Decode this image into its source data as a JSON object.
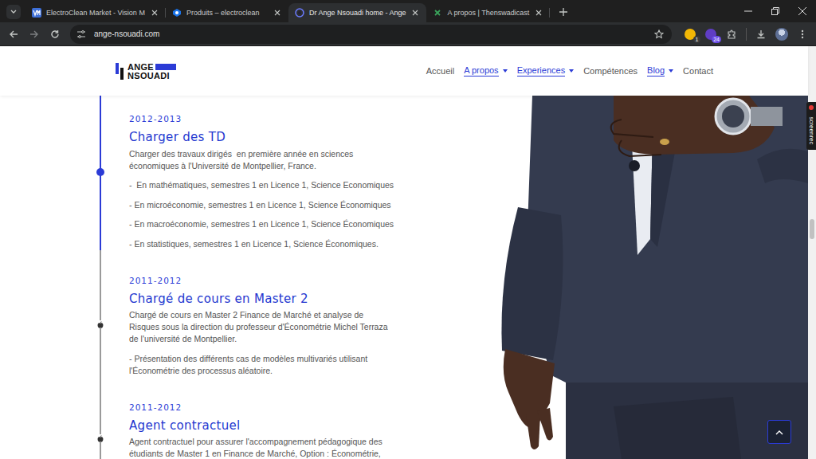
{
  "browser": {
    "tabs": [
      {
        "label": "ElectroClean Market - Vision M",
        "selected": false
      },
      {
        "label": "Produits – electroclean",
        "selected": false
      },
      {
        "label": "Dr Ange Nsouadi home - Ange",
        "selected": true
      },
      {
        "label": "A propos | Thenswadicast",
        "selected": false
      }
    ],
    "url": "ange-nsouadi.com",
    "extensions": [
      {
        "badge": "1",
        "color": "#f2b705"
      },
      {
        "badge": "24",
        "color": "#5f3dc4"
      }
    ]
  },
  "site": {
    "logo": {
      "top": "ANGE",
      "bottom": "NSOUADI"
    },
    "nav": [
      {
        "label": "Accueil",
        "has_dropdown": false
      },
      {
        "label": "A propos",
        "has_dropdown": true
      },
      {
        "label": "Experiences",
        "has_dropdown": true
      },
      {
        "label": "Compétences",
        "has_dropdown": false
      },
      {
        "label": "Blog",
        "has_dropdown": true
      },
      {
        "label": "Contact",
        "has_dropdown": false
      }
    ]
  },
  "timeline": [
    {
      "period": "2012-2013",
      "title": "Charger des TD",
      "active": true,
      "description": [
        "Charger des travaux dirigés  en première année en sciences",
        "économiques à l'Université de Montpellier, France."
      ],
      "bullets": [
        [
          "-  En mathématiques, semestres 1 en Licence 1, Science Economiques"
        ],
        [
          "- En microéconomie, semestres 1 en Licence 1, Science Économiques"
        ],
        [
          "- En macroéconomie, semestres 1 en Licence 1, Science Économiques"
        ],
        [
          "- En statistiques, semestres 1 en Licence 1, Science Économiques."
        ]
      ]
    },
    {
      "period": "2011-2012",
      "title": "Chargé de cours en Master 2",
      "active": false,
      "description": [
        "Chargé de cours en Master 2 Finance de Marché et analyse de",
        "Risques sous la direction du professeur d'Économétrie Michel Terraza",
        "de l'université de Montpellier."
      ],
      "bullets": [
        [
          "- Présentation des différents cas de modèles multivariés utilisant",
          "l'Économétrie des processus aléatoire."
        ]
      ]
    },
    {
      "period": "2011-2012",
      "title": "Agent contractuel",
      "active": false,
      "description": [
        "Agent contractuel pour assurer l'accompagnement pédagogique des",
        "étudiants de Master 1 en Finance de Marché, Option : Économétrie,"
      ],
      "bullets": []
    }
  ],
  "screenrec": {
    "label": "screenrec"
  },
  "scrollbar": {
    "level": 0.44
  }
}
